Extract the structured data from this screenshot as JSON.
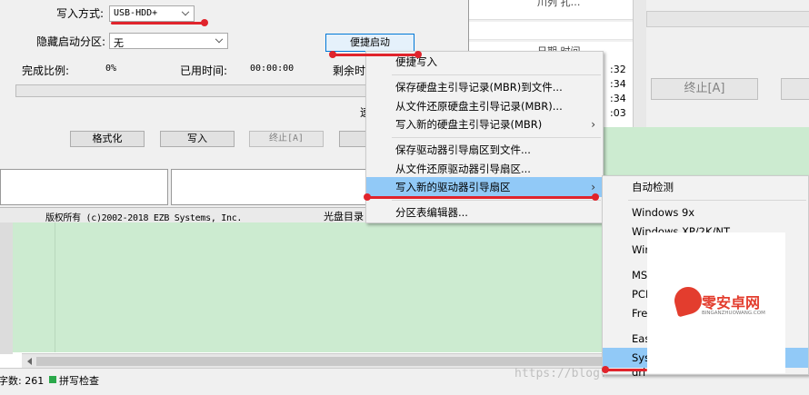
{
  "form": {
    "write_mode_label": "写入方式:",
    "write_mode_value": "USB-HDD+",
    "hide_partition_label": "隐藏启动分区:",
    "hide_partition_value": "无",
    "quick_boot_button": "便捷启动",
    "complete_label": "完成比例:",
    "complete_value": "0%",
    "elapsed_label": "已用时间:",
    "elapsed_value": "00:00:00",
    "remaining_label": "剩余时",
    "speed_fragment": "速",
    "progress": 0
  },
  "buttons": {
    "format": "格式化",
    "write": "写入",
    "abort": "终止[A]",
    "abort_right": "终止[A]"
  },
  "status_bar": {
    "copyright": "版权所有 (c)2002-2018 EZB Systems, Inc.",
    "disc_dir": "光盘目录"
  },
  "right_panel": {
    "header_fragment": "川列 孔…",
    "time_fragment": "日期 时间",
    "times": [
      ":32",
      ":34",
      ":34",
      ":03"
    ]
  },
  "editor_status": {
    "word_count": "字数: 261",
    "spell_check": "拼写检查"
  },
  "watermark": "https://blog.",
  "logo": {
    "name": "零安卓网",
    "sub": "BINGANZHUOWANG.COM"
  },
  "menu_main": {
    "items": [
      "便捷写入",
      "保存硬盘主引导记录(MBR)到文件...",
      "从文件还原硬盘主引导记录(MBR)...",
      "写入新的硬盘主引导记录(MBR)",
      "保存驱动器引导扇区到文件...",
      "从文件还原驱动器引导扇区...",
      "写入新的驱动器引导扇区",
      "分区表编辑器..."
    ]
  },
  "menu_sub": {
    "items": [
      "自动检测",
      "Windows 9x",
      "Windows XP/2K/NT",
      "Wir",
      "MS",
      "PCD",
      "Free",
      "Eas",
      "Sys",
      "grl"
    ]
  },
  "colors": {
    "accent_red": "#e0242c",
    "highlight": "#91c9f7",
    "editor_green": "#ccebd0"
  }
}
